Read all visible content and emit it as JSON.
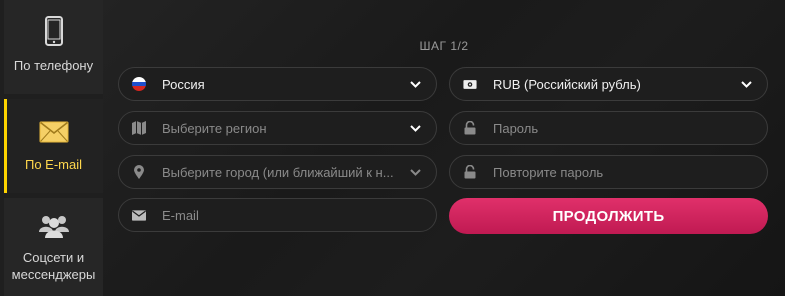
{
  "tabs": [
    {
      "label": "По телефону",
      "icon": "phone-icon"
    },
    {
      "label": "По E-mail",
      "icon": "envelope-icon",
      "active": true
    },
    {
      "label": "Соцсети и мессенджеры",
      "icon": "users-icon"
    }
  ],
  "step": "ШАГ 1/2",
  "form": {
    "country": {
      "value": "Россия",
      "icon": "russia-flag-icon"
    },
    "currency": {
      "value": "RUB (Российский рубль)",
      "icon": "banknote-icon"
    },
    "region": {
      "placeholder": "Выберите регион",
      "icon": "map-icon"
    },
    "password": {
      "placeholder": "Пароль",
      "icon": "lock-icon"
    },
    "city": {
      "placeholder": "Выберите город (или ближайший к н...",
      "icon": "map-pin-icon"
    },
    "password_repeat": {
      "placeholder": "Повторите пароль",
      "icon": "lock-icon"
    },
    "email": {
      "placeholder": "E-mail",
      "icon": "envelope-icon"
    },
    "submit_label": "ПРОДОЛЖИТЬ"
  },
  "colors": {
    "accent_active_tab": "#ffd400",
    "submit_button": "#d02660"
  }
}
